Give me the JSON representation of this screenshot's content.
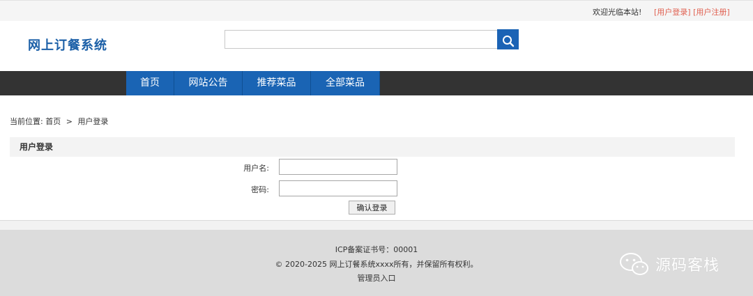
{
  "topbar": {
    "welcome": "欢迎光临本站!",
    "login_link": "[用户登录]",
    "register_link": "[用户注册]"
  },
  "header": {
    "site_title": "网上订餐系统",
    "search": {
      "value": "",
      "placeholder": ""
    },
    "search_icon": "search-icon"
  },
  "nav": {
    "items": [
      {
        "label": "首页"
      },
      {
        "label": "网站公告"
      },
      {
        "label": "推荐菜品"
      },
      {
        "label": "全部菜品"
      }
    ]
  },
  "breadcrumb": {
    "prefix": "当前位置:",
    "home": "首页",
    "separator": ">",
    "current": "用户登录"
  },
  "login": {
    "panel_title": "用户登录",
    "username_label": "用户名:",
    "username_value": "",
    "password_label": "密码:",
    "password_value": "",
    "submit_label": "确认登录"
  },
  "footer": {
    "icp": "ICP备案证书号：00001",
    "copyright": "© 2020-2025 网上订餐系统xxxx所有，并保留所有权利。",
    "admin_link": "管理员入口"
  },
  "watermark": {
    "text": "源码客栈",
    "icon": "wechat-icon"
  },
  "colors": {
    "brand_blue": "#1b5fa7",
    "nav_blue": "#1a64b4",
    "nav_bar": "#333333",
    "link_red": "#e06050"
  }
}
